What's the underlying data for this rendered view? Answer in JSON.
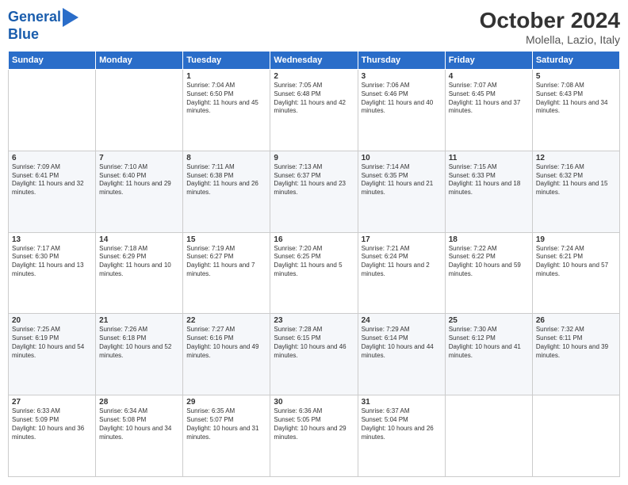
{
  "header": {
    "logo_line1": "General",
    "logo_line2": "Blue",
    "title": "October 2024",
    "location": "Molella, Lazio, Italy"
  },
  "weekdays": [
    "Sunday",
    "Monday",
    "Tuesday",
    "Wednesday",
    "Thursday",
    "Friday",
    "Saturday"
  ],
  "weeks": [
    [
      {
        "day": "",
        "info": ""
      },
      {
        "day": "",
        "info": ""
      },
      {
        "day": "1",
        "info": "Sunrise: 7:04 AM\nSunset: 6:50 PM\nDaylight: 11 hours and 45 minutes."
      },
      {
        "day": "2",
        "info": "Sunrise: 7:05 AM\nSunset: 6:48 PM\nDaylight: 11 hours and 42 minutes."
      },
      {
        "day": "3",
        "info": "Sunrise: 7:06 AM\nSunset: 6:46 PM\nDaylight: 11 hours and 40 minutes."
      },
      {
        "day": "4",
        "info": "Sunrise: 7:07 AM\nSunset: 6:45 PM\nDaylight: 11 hours and 37 minutes."
      },
      {
        "day": "5",
        "info": "Sunrise: 7:08 AM\nSunset: 6:43 PM\nDaylight: 11 hours and 34 minutes."
      }
    ],
    [
      {
        "day": "6",
        "info": "Sunrise: 7:09 AM\nSunset: 6:41 PM\nDaylight: 11 hours and 32 minutes."
      },
      {
        "day": "7",
        "info": "Sunrise: 7:10 AM\nSunset: 6:40 PM\nDaylight: 11 hours and 29 minutes."
      },
      {
        "day": "8",
        "info": "Sunrise: 7:11 AM\nSunset: 6:38 PM\nDaylight: 11 hours and 26 minutes."
      },
      {
        "day": "9",
        "info": "Sunrise: 7:13 AM\nSunset: 6:37 PM\nDaylight: 11 hours and 23 minutes."
      },
      {
        "day": "10",
        "info": "Sunrise: 7:14 AM\nSunset: 6:35 PM\nDaylight: 11 hours and 21 minutes."
      },
      {
        "day": "11",
        "info": "Sunrise: 7:15 AM\nSunset: 6:33 PM\nDaylight: 11 hours and 18 minutes."
      },
      {
        "day": "12",
        "info": "Sunrise: 7:16 AM\nSunset: 6:32 PM\nDaylight: 11 hours and 15 minutes."
      }
    ],
    [
      {
        "day": "13",
        "info": "Sunrise: 7:17 AM\nSunset: 6:30 PM\nDaylight: 11 hours and 13 minutes."
      },
      {
        "day": "14",
        "info": "Sunrise: 7:18 AM\nSunset: 6:29 PM\nDaylight: 11 hours and 10 minutes."
      },
      {
        "day": "15",
        "info": "Sunrise: 7:19 AM\nSunset: 6:27 PM\nDaylight: 11 hours and 7 minutes."
      },
      {
        "day": "16",
        "info": "Sunrise: 7:20 AM\nSunset: 6:25 PM\nDaylight: 11 hours and 5 minutes."
      },
      {
        "day": "17",
        "info": "Sunrise: 7:21 AM\nSunset: 6:24 PM\nDaylight: 11 hours and 2 minutes."
      },
      {
        "day": "18",
        "info": "Sunrise: 7:22 AM\nSunset: 6:22 PM\nDaylight: 10 hours and 59 minutes."
      },
      {
        "day": "19",
        "info": "Sunrise: 7:24 AM\nSunset: 6:21 PM\nDaylight: 10 hours and 57 minutes."
      }
    ],
    [
      {
        "day": "20",
        "info": "Sunrise: 7:25 AM\nSunset: 6:19 PM\nDaylight: 10 hours and 54 minutes."
      },
      {
        "day": "21",
        "info": "Sunrise: 7:26 AM\nSunset: 6:18 PM\nDaylight: 10 hours and 52 minutes."
      },
      {
        "day": "22",
        "info": "Sunrise: 7:27 AM\nSunset: 6:16 PM\nDaylight: 10 hours and 49 minutes."
      },
      {
        "day": "23",
        "info": "Sunrise: 7:28 AM\nSunset: 6:15 PM\nDaylight: 10 hours and 46 minutes."
      },
      {
        "day": "24",
        "info": "Sunrise: 7:29 AM\nSunset: 6:14 PM\nDaylight: 10 hours and 44 minutes."
      },
      {
        "day": "25",
        "info": "Sunrise: 7:30 AM\nSunset: 6:12 PM\nDaylight: 10 hours and 41 minutes."
      },
      {
        "day": "26",
        "info": "Sunrise: 7:32 AM\nSunset: 6:11 PM\nDaylight: 10 hours and 39 minutes."
      }
    ],
    [
      {
        "day": "27",
        "info": "Sunrise: 6:33 AM\nSunset: 5:09 PM\nDaylight: 10 hours and 36 minutes."
      },
      {
        "day": "28",
        "info": "Sunrise: 6:34 AM\nSunset: 5:08 PM\nDaylight: 10 hours and 34 minutes."
      },
      {
        "day": "29",
        "info": "Sunrise: 6:35 AM\nSunset: 5:07 PM\nDaylight: 10 hours and 31 minutes."
      },
      {
        "day": "30",
        "info": "Sunrise: 6:36 AM\nSunset: 5:05 PM\nDaylight: 10 hours and 29 minutes."
      },
      {
        "day": "31",
        "info": "Sunrise: 6:37 AM\nSunset: 5:04 PM\nDaylight: 10 hours and 26 minutes."
      },
      {
        "day": "",
        "info": ""
      },
      {
        "day": "",
        "info": ""
      }
    ]
  ]
}
